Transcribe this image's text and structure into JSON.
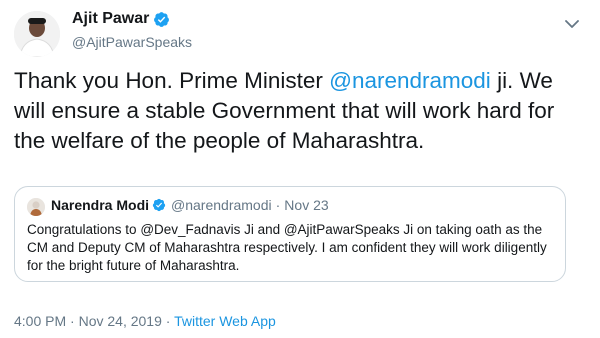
{
  "author": {
    "name": "Ajit Pawar",
    "handle": "@AjitPawarSpeaks"
  },
  "tweet": {
    "text_before": "Thank you Hon. Prime Minister ",
    "mention": "@narendramodi",
    "text_after": " ji. We will ensure a stable Government that will work hard for the welfare of the people of Maharashtra."
  },
  "quoted": {
    "name": "Narendra Modi",
    "handle": "@narendramodi",
    "separator": "·",
    "date": "Nov 23",
    "text": "Congratulations to @Dev_Fadnavis Ji and @AjitPawarSpeaks Ji on taking oath as the CM and Deputy CM of Maharashtra respectively. I am confident they will work diligently for the bright future of Maharashtra."
  },
  "meta": {
    "time": "4:00 PM",
    "separator1": " · ",
    "date": "Nov 24, 2019",
    "separator2": " · ",
    "source": "Twitter Web App"
  },
  "icons": {
    "verified": "verified-badge-icon",
    "caret": "chevron-down-icon"
  },
  "colors": {
    "link": "#1b95e0",
    "verified": "#1da1f2",
    "secondary_text": "#657786",
    "border": "#ccd6dd"
  }
}
